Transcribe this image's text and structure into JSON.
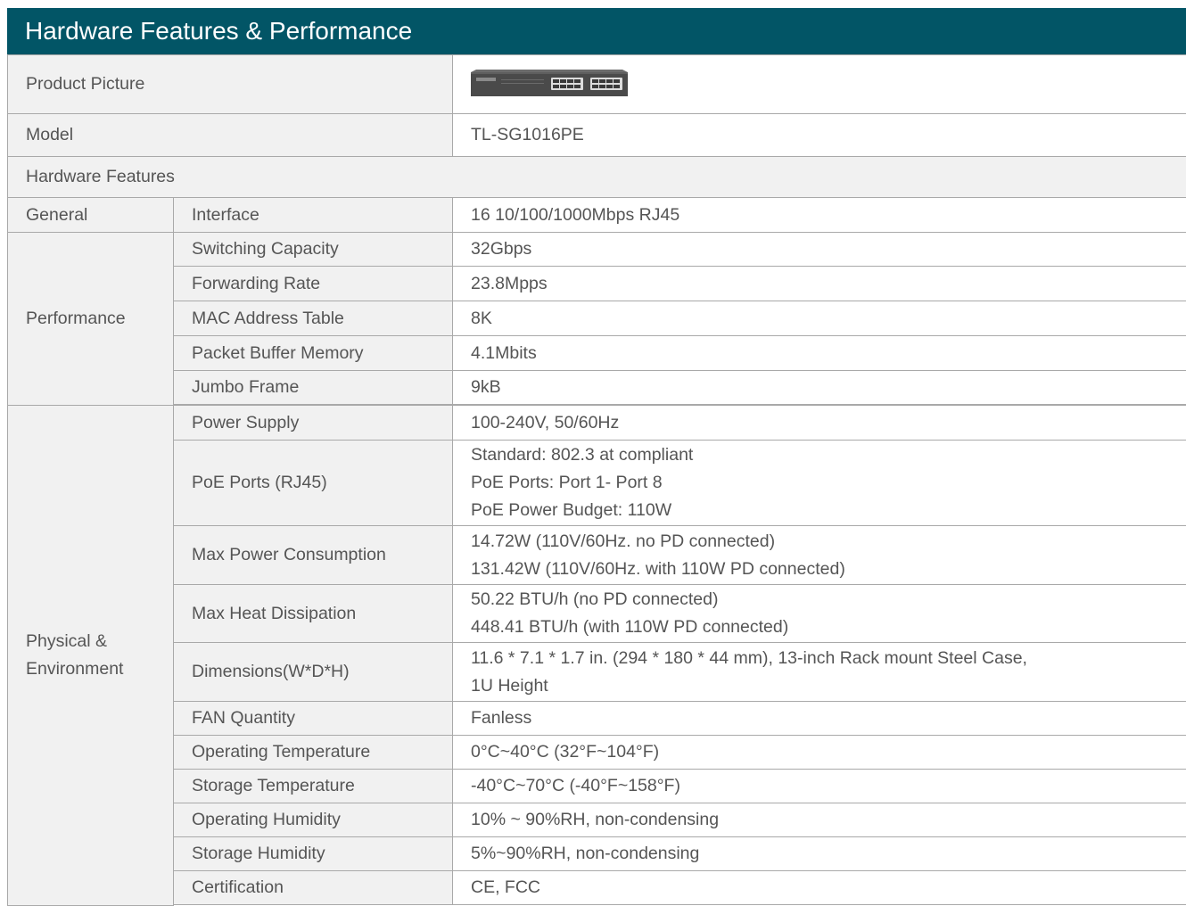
{
  "header": {
    "title": "Hardware Features & Performance"
  },
  "product_picture": {
    "label": "Product Picture",
    "image_icon": "network-switch-image"
  },
  "model": {
    "label": "Model",
    "value": "TL-SG1016PE"
  },
  "section_title": "Hardware Features",
  "groups": {
    "general": "General",
    "performance": "Performance",
    "physical": [
      "Physical &",
      "Environment"
    ]
  },
  "rows": {
    "interface": {
      "label": "Interface",
      "value": "16 10/100/1000Mbps RJ45"
    },
    "switching_capacity": {
      "label": "Switching Capacity",
      "value": "32Gbps"
    },
    "forwarding_rate": {
      "label": "Forwarding Rate",
      "value": "23.8Mpps"
    },
    "mac_table": {
      "label": "MAC Address Table",
      "value": "8K"
    },
    "packet_buffer": {
      "label": "Packet Buffer Memory",
      "value": "4.1Mbits"
    },
    "jumbo_frame": {
      "label": "Jumbo Frame",
      "value": "9kB"
    },
    "power_supply": {
      "label": "Power Supply",
      "value": "100-240V, 50/60Hz"
    },
    "poe_ports": {
      "label": "PoE Ports (RJ45)",
      "lines": [
        "Standard: 802.3 at compliant",
        "PoE Ports: Port 1- Port 8",
        "PoE Power Budget: 110W"
      ]
    },
    "max_power": {
      "label": "Max Power Consumption",
      "lines": [
        "14.72W (110V/60Hz. no PD connected)",
        "131.42W (110V/60Hz. with 110W PD connected)"
      ]
    },
    "max_heat": {
      "label": "Max Heat Dissipation",
      "lines": [
        "50.22 BTU/h (no PD connected)",
        "448.41 BTU/h (with 110W PD connected)"
      ]
    },
    "dimensions": {
      "label": "Dimensions(W*D*H)",
      "lines": [
        "11.6 * 7.1 * 1.7 in. (294 * 180 * 44 mm), 13-inch Rack mount Steel Case,",
        "1U Height"
      ]
    },
    "fan": {
      "label": "FAN Quantity",
      "value": "Fanless"
    },
    "op_temp": {
      "label": "Operating Temperature",
      "value": "0°C~40°C (32°F~104°F)"
    },
    "st_temp": {
      "label": "Storage Temperature",
      "value": "-40°C~70°C (-40°F~158°F)"
    },
    "op_hum": {
      "label": "Operating Humidity",
      "value": "10% ~ 90%RH, non-condensing"
    },
    "st_hum": {
      "label": "Storage Humidity",
      "value": "5%~90%RH, non-condensing"
    },
    "cert": {
      "label": "Certification",
      "value": "CE, FCC"
    }
  }
}
